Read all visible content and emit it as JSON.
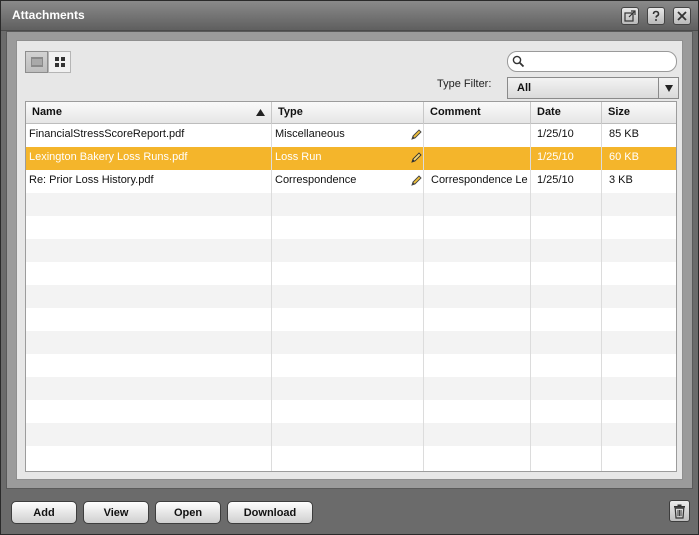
{
  "window": {
    "title": "Attachments"
  },
  "search": {
    "placeholder": "",
    "value": ""
  },
  "type_filter": {
    "label": "Type Filter:",
    "value": "All"
  },
  "grid": {
    "columns": [
      "Name",
      "Type",
      "Comment",
      "Date",
      "Size"
    ],
    "sorted_column": "Name",
    "sort_direction": "ascending",
    "rows": [
      {
        "name": "FinancialStressScoreReport.pdf",
        "type": "Miscellaneous",
        "comment": "",
        "date": "1/25/10",
        "size": "85 KB",
        "selected": false
      },
      {
        "name": "Lexington Bakery Loss Runs.pdf",
        "type": "Loss Run",
        "comment": "",
        "date": "1/25/10",
        "size": "60 KB",
        "selected": true
      },
      {
        "name": "Re: Prior Loss History.pdf",
        "type": "Correspondence",
        "comment": "Correspondence Le",
        "date": "1/25/10",
        "size": "3 KB",
        "selected": false
      }
    ]
  },
  "buttons": {
    "add": "Add",
    "view": "View",
    "open": "Open",
    "download": "Download"
  },
  "colors": {
    "selection": "#f4b52b",
    "frame": "#6b6b6b"
  }
}
